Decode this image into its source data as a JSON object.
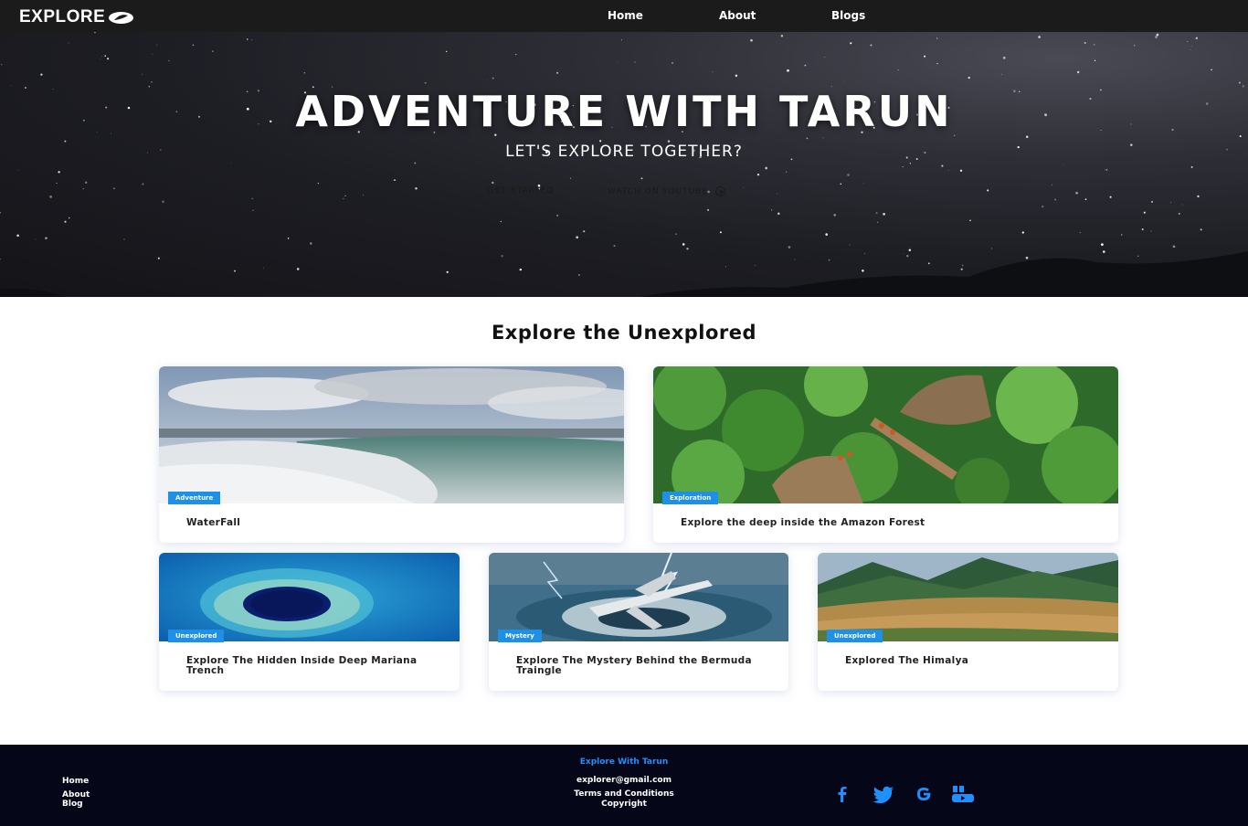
{
  "nav": {
    "logo": "EXPLORE",
    "links": [
      "Home",
      "About",
      "Blogs"
    ]
  },
  "hero": {
    "title": "ADVENTURE WITH TARUN",
    "subtitle": "LET'S EXPLORE TOGETHER?",
    "cta_primary": "GET STARTED",
    "cta_secondary": "WATCH ON YOUTUBE"
  },
  "section": {
    "title": "Explore the Unexplored"
  },
  "cards": [
    {
      "tag": "Adventure",
      "title": "WaterFall"
    },
    {
      "tag": "Exploration",
      "title": "Explore the deep inside the Amazon Forest"
    },
    {
      "tag": "Unexplored",
      "title": "Explore The Hidden Inside Deep Mariana Trench"
    },
    {
      "tag": "Mystery",
      "title": "Explore The Mystery Behind the Bermuda Traingle"
    },
    {
      "tag": "Unexplored",
      "title": "Explored The Himalya"
    }
  ],
  "footer": {
    "brand": "Explore With Tarun",
    "links": [
      "Home",
      "About",
      "Blog"
    ],
    "email": "explorer@gmail.com",
    "terms": "Terms and Conditions",
    "copyright": "Copyright",
    "social_icons": [
      "facebook-icon",
      "twitter-icon",
      "google-icon",
      "youtube-icon"
    ],
    "accent_color": "#1e90ff"
  }
}
